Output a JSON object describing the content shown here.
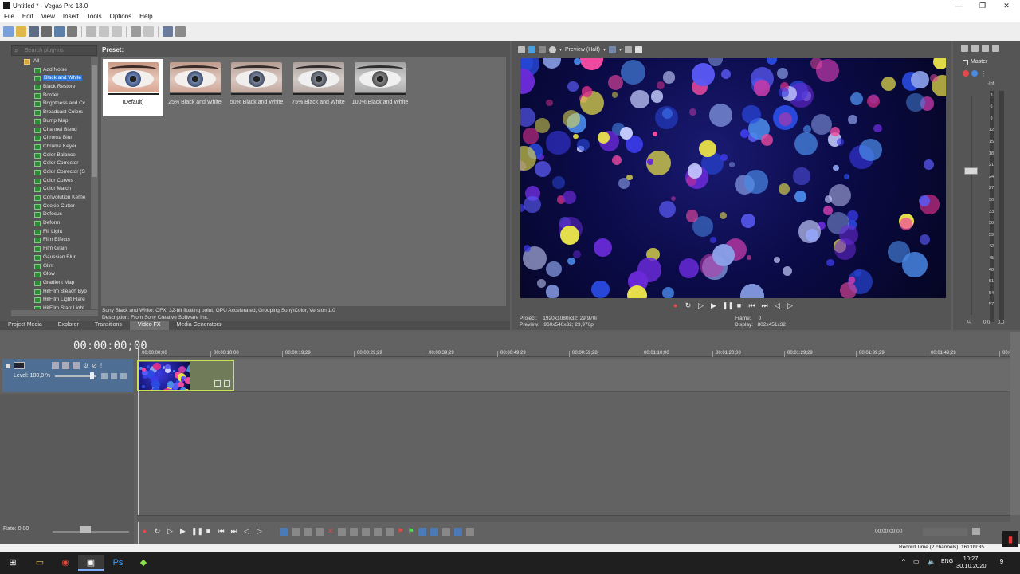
{
  "window": {
    "title": "Untitled * - Vegas Pro 13.0",
    "controls": {
      "minimize": "—",
      "maximize": "❐",
      "close": "✕"
    }
  },
  "menu": [
    "File",
    "Edit",
    "View",
    "Insert",
    "Tools",
    "Options",
    "Help"
  ],
  "plugins": {
    "search_placeholder": "Search plug-ins",
    "root": "All",
    "items": [
      "Add Noise",
      "Black and White",
      "Black Restore",
      "Border",
      "Brightness and Cc",
      "Broadcast Colors",
      "Bump Map",
      "Channel Blend",
      "Chroma Blur",
      "Chroma Keyer",
      "Color Balance",
      "Color Corrector",
      "Color Corrector (S",
      "Color Curves",
      "Color Match",
      "Convolution Kerne",
      "Cookie Cutter",
      "Defocus",
      "Deform",
      "Fill Light",
      "Film Effects",
      "Film Grain",
      "Gaussian Blur",
      "Glint",
      "Glow",
      "Gradient Map",
      "HitFilm Bleach Byp",
      "HitFilm Light Flare",
      "HitFilm Starr Light"
    ],
    "selected_index": 1
  },
  "presets": {
    "label": "Preset:",
    "items": [
      "(Default)",
      "25% Black and White",
      "50% Black and White",
      "75% Black and White",
      "100% Black and White"
    ],
    "selected_index": 0
  },
  "description": {
    "line1": "Sony Black and White: OFX, 32-bit floating point, GPU Accelerated, Grouping Sony\\Color, Version 1.0",
    "line2": "Description: From Sony Creative Software Inc."
  },
  "left_tabs": [
    "Project Media",
    "Explorer",
    "Transitions",
    "Video FX",
    "Media Generators"
  ],
  "left_tabs_active": 3,
  "preview": {
    "quality": "Preview (Half)",
    "project_label": "Project:",
    "project_value": "1920x1080x32; 29,970i",
    "preview_label": "Preview:",
    "preview_value": "960x540x32; 29,970p",
    "frame_label": "Frame:",
    "frame_value": "0",
    "display_label": "Display:",
    "display_value": "802x451x32"
  },
  "master": {
    "label": "Master",
    "scale": [
      "-Inf.",
      "3",
      "6",
      "9",
      "12",
      "15",
      "18",
      "21",
      "24",
      "27",
      "30",
      "33",
      "36",
      "39",
      "42",
      "45",
      "48",
      "51",
      "54",
      "57"
    ],
    "bottom_left": "0,0",
    "bottom_right": "0,0"
  },
  "timeline": {
    "timecode": "00:00:00;00",
    "ruler": [
      "00:00:00;00",
      "00:00:10;00",
      "00:00:19;29",
      "00:00:29;29",
      "00:00:39;29",
      "00:00:49;29",
      "00:00:59;28",
      "00:01:10;00",
      "00:01:20;00",
      "00:01:29;29",
      "00:01:39;29",
      "00:01:49;29",
      "00:0"
    ],
    "track_level": "Level: 100,0 %",
    "rate": "Rate: 0,00",
    "cursor_time": "00:00:00;00",
    "record_time": "Record Time (2 channels): 161:09:35"
  },
  "taskbar": {
    "lang": "ENG",
    "time": "10:27",
    "date": "30.10.2020",
    "notifications": "9"
  },
  "colors": {
    "selection": "#2f78d8",
    "track_header": "#4e6f93",
    "clip_border": "#c8e05a",
    "playhead": "#e8d640"
  }
}
